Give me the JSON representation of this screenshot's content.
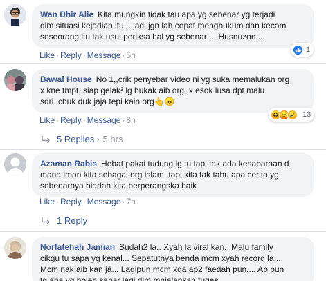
{
  "comments": [
    {
      "author": "Wan Dhir Alie",
      "lines": [
        "Kita mungkin tidak tau apa yg sebenar yg terjadi",
        "dlm situasi kejadian itu ...jadi jgn lah cepat menghukum dan kecam",
        "seseorang itu tak usul periksa hal yg sebenar ... Husnuzon...."
      ],
      "like": "Like",
      "reply": "Reply",
      "message": "Message",
      "time": "5h",
      "reaction_count": "1",
      "reactions": [
        "like-icon"
      ]
    },
    {
      "author": "Bawal House",
      "lines": [
        "No 1,,crik penyebar video ni yg suka memalukan org",
        "x kne tmpt,,siap gelak² lg bukak aib org,,x esok lusa dpt malu",
        "sdri..cbuk duk jaja tepi kain org👆😠"
      ],
      "like": "Like",
      "reply": "Reply",
      "message": "Message",
      "time": "8h",
      "reaction_count": "13",
      "reactions": [
        "haha-icon",
        "angry-icon",
        "sad-icon"
      ],
      "replies_label": "5 Replies",
      "replies_time": "5 hrs"
    },
    {
      "author": "Azaman Rabis",
      "lines": [
        "Hebat pakai tudung lg tu tapi tak ada kesabaraan d",
        "mana iman kita sebagai org islam .tapi kita tak tahu apa cerita yg",
        "sebenarnya biarlah kita berperangska baik"
      ],
      "like": "Like",
      "reply": "Reply",
      "message": "Message",
      "time": "7h",
      "replies_label": "1 Reply"
    },
    {
      "author": "Norfatehah Jamian",
      "lines": [
        "Sudah2 la.. Xyah la viral kan.. Malu family",
        "cikgu tu sapa yg kenal... Sepatutnya benda mcm xyah record la...",
        "Mcm nak aib kan já... Lagipun mcm xda ap2 faedah pun.... Ap pun",
        "tg aba yg boleh sabar lagi dlm mnjalankan tugas"
      ]
    }
  ],
  "colors": {
    "link": "#385898",
    "bubble": "#f2f3f5",
    "like_blue": "#1877f2",
    "haha_yellow": "#f7b125",
    "angry_orange": "#e9710f"
  }
}
